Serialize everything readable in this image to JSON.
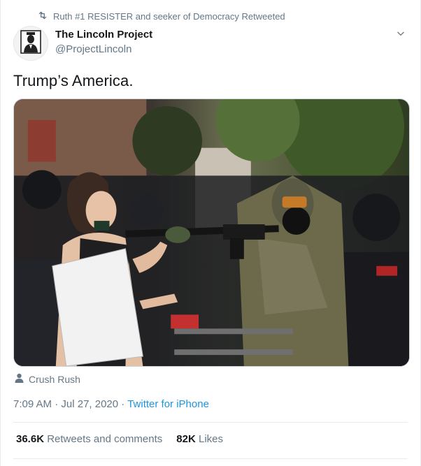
{
  "retweet": {
    "icon": "retweet-icon",
    "text": "Ruth #1 RESISTER and seeker of Democracy Retweeted"
  },
  "author": {
    "name": "The Lincoln Project",
    "handle": "@ProjectLincoln",
    "avatar_icon": "lincoln-portrait-avatar"
  },
  "tweet": {
    "text": "Trump’s America.",
    "media_alt": "photo"
  },
  "tag": {
    "icon": "person-icon",
    "name": "Crush Rush"
  },
  "meta": {
    "time": "7:09 AM",
    "separator": " · ",
    "date": "Jul 27, 2020",
    "source": "Twitter for iPhone"
  },
  "stats": {
    "retweets_count": "36.6K",
    "retweets_label": "Retweets and comments",
    "likes_count": "82K",
    "likes_label": "Likes"
  },
  "colors": {
    "link": "#1b95e0",
    "secondary_text": "#657786",
    "primary_text": "#14171a"
  }
}
